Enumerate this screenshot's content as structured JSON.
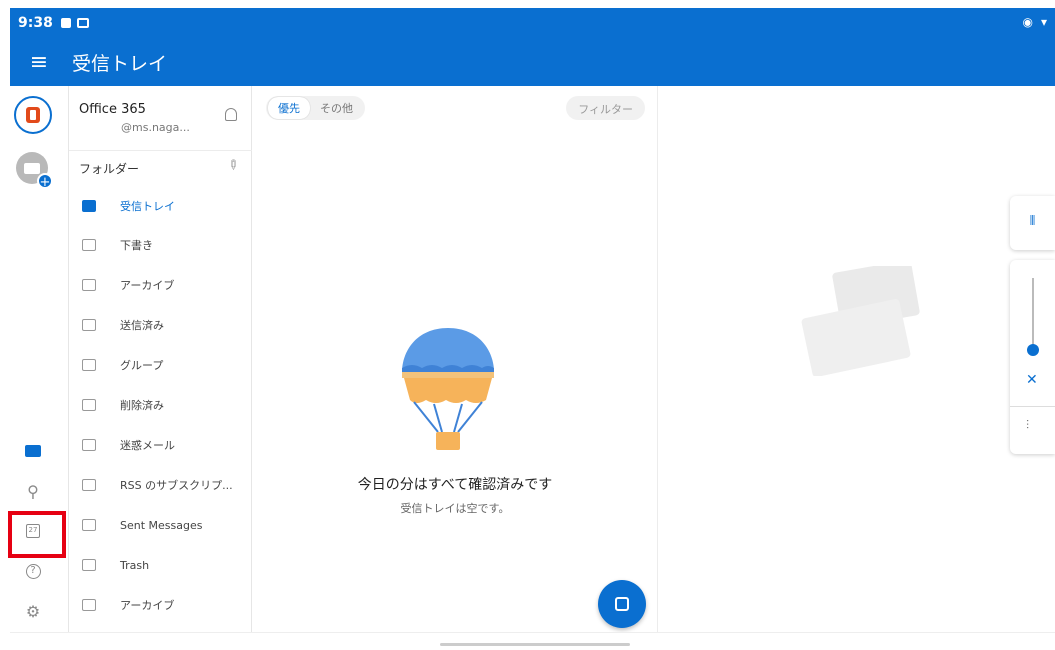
{
  "status": {
    "time": "9:38"
  },
  "appbar": {
    "title": "受信トレイ",
    "menu_icon": "hamburger-icon"
  },
  "account": {
    "name": "Office 365",
    "email": "@ms.naga..."
  },
  "folders": {
    "header": "フォルダー",
    "items": [
      {
        "label": "受信トレイ",
        "icon": "inbox-icon",
        "selected": true
      },
      {
        "label": "下書き",
        "icon": "drafts-icon",
        "selected": false
      },
      {
        "label": "アーカイブ",
        "icon": "archive-icon",
        "selected": false
      },
      {
        "label": "送信済み",
        "icon": "sent-icon",
        "selected": false
      },
      {
        "label": "グループ",
        "icon": "groups-icon",
        "selected": false
      },
      {
        "label": "削除済み",
        "icon": "trash-icon",
        "selected": false
      },
      {
        "label": "迷惑メール",
        "icon": "junk-icon",
        "selected": false
      },
      {
        "label": "RSS のサブスクリプ...",
        "icon": "folder-icon",
        "selected": false
      },
      {
        "label": "Sent Messages",
        "icon": "folder-icon",
        "selected": false
      },
      {
        "label": "Trash",
        "icon": "folder-icon",
        "selected": false
      },
      {
        "label": "アーカイブ",
        "icon": "folder-icon",
        "selected": false
      }
    ]
  },
  "list": {
    "tab_focused": "優先",
    "tab_other": "その他",
    "filter": "フィルター",
    "empty_title": "今日の分はすべて確認済みです",
    "empty_subtitle": "受信トレイは空です。"
  },
  "rail": {
    "items": [
      "mail-icon",
      "search-icon",
      "calendar-icon",
      "help-icon",
      "settings-icon"
    ],
    "calendar_day": "27"
  },
  "colors": {
    "accent": "#0a6fd0",
    "highlight": "#e60012"
  }
}
